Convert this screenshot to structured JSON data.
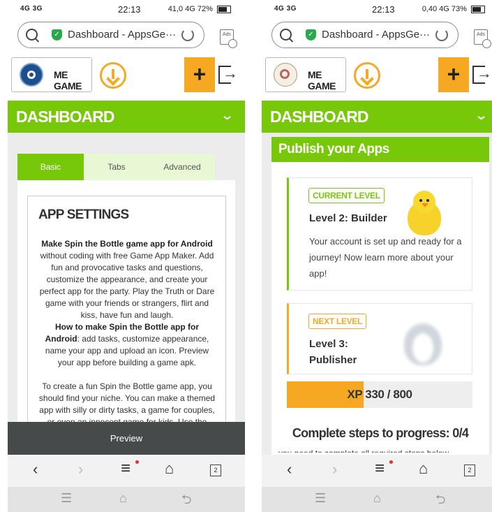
{
  "left": {
    "status": {
      "signal": "4G 3G",
      "time": "22:13",
      "net_speed": "41,0",
      "battery_pct": "72%"
    },
    "browser": {
      "url_text": "Dashboard - AppsGe···",
      "ads_label": "Ads"
    },
    "header": {
      "logo_text": "ME GAME",
      "plus_label": "+"
    },
    "dashboard": {
      "title": "DASHBOARD"
    },
    "tabs": [
      {
        "label": "Basic"
      },
      {
        "label": "Tabs"
      },
      {
        "label": "Advanced"
      }
    ],
    "settings": {
      "heading": "APP SETTINGS",
      "p1_bold": "Make Spin the Bottle game app for Android",
      "p1_text": " without coding with free Game App Maker. Add fun and provocative tasks and questions, customize the appearance, and create your perfect app for the party. Play the Truth or Dare game with your friends or strangers, flirt and kiss, have fun and laugh.",
      "p2_bold": "How to make Spin the Bottle app for Android",
      "p2_text": ": add tasks, customize appearance, name your app and upload an icon. Preview your app before building a game apk.",
      "p3_text": "To create a fun Spin the Bottle game app, you should find your niche. You can make a themed app with silly or dirty tasks, a game for couples, or even an innocent game for kids. Use the keywords in the name and description, localize your word search app into"
    },
    "preview_label": "Preview",
    "nav": {
      "back": "‹",
      "forward": "›",
      "menu": "≡",
      "home": "⌂",
      "tab_count": "2"
    }
  },
  "right": {
    "status": {
      "signal": "4G 3G",
      "time": "22:13",
      "net_speed": "0,40",
      "battery_pct": "73%"
    },
    "browser": {
      "url_text": "Dashboard - AppsGe···",
      "ads_label": "Ads"
    },
    "header": {
      "logo_text": "ME GAME",
      "plus_label": "+"
    },
    "dashboard": {
      "title": "DASHBOARD"
    },
    "publish": {
      "title": "Publish your Apps",
      "current": {
        "badge": "CURRENT LEVEL",
        "name": "Level 2: Builder",
        "desc": "Your account is set up and ready for a journey! Now learn more about your app!"
      },
      "next": {
        "badge": "NEXT LEVEL",
        "name": "Level 3: Publisher"
      },
      "xp": {
        "text": "XP 330 / 800",
        "value": 330,
        "max": 800
      },
      "steps": "Complete steps to progress: 0/4",
      "cut_text": "you need to complete all required steps below"
    },
    "nav": {
      "back": "‹",
      "forward": "›",
      "menu": "≡",
      "home": "⌂",
      "tab_count": "2"
    }
  },
  "colors": {
    "green": "#78c80a",
    "orange": "#f7a823",
    "preview_bar": "#474a4b"
  }
}
